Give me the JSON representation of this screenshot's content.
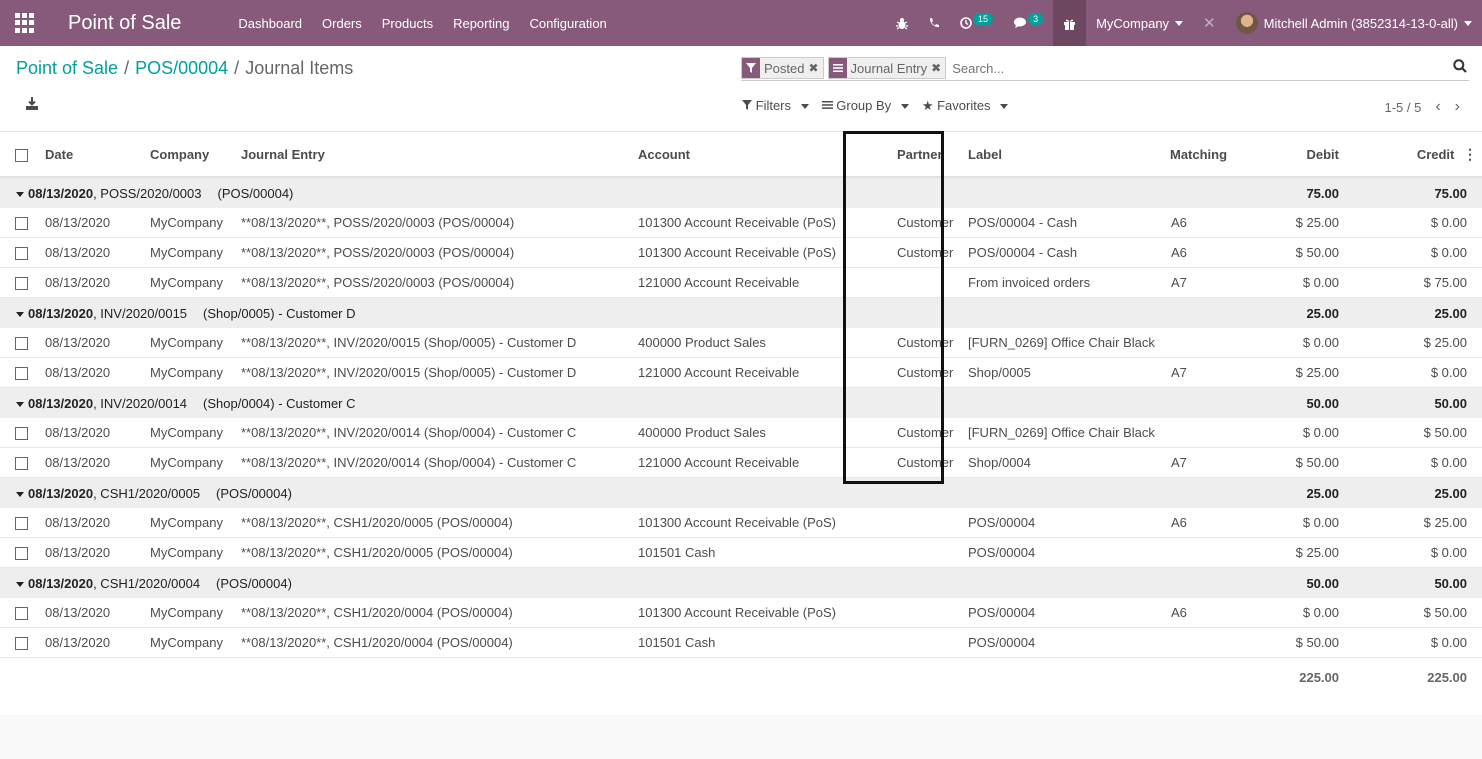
{
  "navbar": {
    "app_name": "Point of Sale",
    "menu": [
      "Dashboard",
      "Orders",
      "Products",
      "Reporting",
      "Configuration"
    ],
    "activity_count": "15",
    "message_count": "3",
    "company": "MyCompany",
    "user": "Mitchell Admin (3852314-13-0-all)"
  },
  "breadcrumb": {
    "root": "Point of Sale",
    "session": "POS/00004",
    "current": "Journal Items"
  },
  "search": {
    "facets": [
      {
        "icon": "filter-icon",
        "value": "Posted"
      },
      {
        "icon": "group-by-icon",
        "value": "Journal Entry"
      }
    ],
    "placeholder": "Search..."
  },
  "controls": {
    "filters": "Filters",
    "group_by": "Group By",
    "favorites": "Favorites",
    "pager": "1-5 / 5"
  },
  "table": {
    "columns": [
      "Date",
      "Company",
      "Journal Entry",
      "Account",
      "Partner",
      "Label",
      "Matching",
      "Debit",
      "Credit"
    ],
    "groups": [
      {
        "date": "08/13/2020",
        "ref": ", POSS/2020/0003",
        "suffix": "(POS/00004)",
        "debit": "75.00",
        "credit": "75.00",
        "rows": [
          {
            "date": "08/13/2020",
            "company": "MyCompany",
            "entry": "**08/13/2020**, POSS/2020/0003 (POS/00004)",
            "account": "101300 Account Receivable (PoS)",
            "partner": "Customer D",
            "label": "POS/00004 - Cash",
            "matching": "A6",
            "debit": "$ 25.00",
            "credit": "$ 0.00"
          },
          {
            "date": "08/13/2020",
            "company": "MyCompany",
            "entry": "**08/13/2020**, POSS/2020/0003 (POS/00004)",
            "account": "101300 Account Receivable (PoS)",
            "partner": "Customer C",
            "label": "POS/00004 - Cash",
            "matching": "A6",
            "debit": "$ 50.00",
            "credit": "$ 0.00"
          },
          {
            "date": "08/13/2020",
            "company": "MyCompany",
            "entry": "**08/13/2020**, POSS/2020/0003 (POS/00004)",
            "account": "121000 Account Receivable",
            "partner": "",
            "label": "From invoiced orders",
            "matching": "A7",
            "debit": "$ 0.00",
            "credit": "$ 75.00"
          }
        ]
      },
      {
        "date": "08/13/2020",
        "ref": ", INV/2020/0015",
        "suffix": "(Shop/0005) - Customer D",
        "debit": "25.00",
        "credit": "25.00",
        "rows": [
          {
            "date": "08/13/2020",
            "company": "MyCompany",
            "entry": "**08/13/2020**, INV/2020/0015 (Shop/0005) - Customer D",
            "account": "400000 Product Sales",
            "partner": "Customer D",
            "label": "[FURN_0269] Office Chair Black",
            "matching": "",
            "debit": "$ 0.00",
            "credit": "$ 25.00"
          },
          {
            "date": "08/13/2020",
            "company": "MyCompany",
            "entry": "**08/13/2020**, INV/2020/0015 (Shop/0005) - Customer D",
            "account": "121000 Account Receivable",
            "partner": "Customer D",
            "label": "Shop/0005",
            "matching": "A7",
            "debit": "$ 25.00",
            "credit": "$ 0.00"
          }
        ]
      },
      {
        "date": "08/13/2020",
        "ref": ", INV/2020/0014",
        "suffix": "(Shop/0004) - Customer C",
        "debit": "50.00",
        "credit": "50.00",
        "rows": [
          {
            "date": "08/13/2020",
            "company": "MyCompany",
            "entry": "**08/13/2020**, INV/2020/0014 (Shop/0004) - Customer C",
            "account": "400000 Product Sales",
            "partner": "Customer C",
            "label": "[FURN_0269] Office Chair Black",
            "matching": "",
            "debit": "$ 0.00",
            "credit": "$ 50.00"
          },
          {
            "date": "08/13/2020",
            "company": "MyCompany",
            "entry": "**08/13/2020**, INV/2020/0014 (Shop/0004) - Customer C",
            "account": "121000 Account Receivable",
            "partner": "Customer C",
            "label": "Shop/0004",
            "matching": "A7",
            "debit": "$ 50.00",
            "credit": "$ 0.00"
          }
        ]
      },
      {
        "date": "08/13/2020",
        "ref": ", CSH1/2020/0005",
        "suffix": "(POS/00004)",
        "debit": "25.00",
        "credit": "25.00",
        "rows": [
          {
            "date": "08/13/2020",
            "company": "MyCompany",
            "entry": "**08/13/2020**, CSH1/2020/0005 (POS/00004)",
            "account": "101300 Account Receivable (PoS)",
            "partner": "",
            "label": "POS/00004",
            "matching": "A6",
            "debit": "$ 0.00",
            "credit": "$ 25.00"
          },
          {
            "date": "08/13/2020",
            "company": "MyCompany",
            "entry": "**08/13/2020**, CSH1/2020/0005 (POS/00004)",
            "account": "101501 Cash",
            "partner": "",
            "label": "POS/00004",
            "matching": "",
            "debit": "$ 25.00",
            "credit": "$ 0.00"
          }
        ]
      },
      {
        "date": "08/13/2020",
        "ref": ", CSH1/2020/0004",
        "suffix": "(POS/00004)",
        "debit": "50.00",
        "credit": "50.00",
        "rows": [
          {
            "date": "08/13/2020",
            "company": "MyCompany",
            "entry": "**08/13/2020**, CSH1/2020/0004 (POS/00004)",
            "account": "101300 Account Receivable (PoS)",
            "partner": "",
            "label": "POS/00004",
            "matching": "A6",
            "debit": "$ 0.00",
            "credit": "$ 50.00"
          },
          {
            "date": "08/13/2020",
            "company": "MyCompany",
            "entry": "**08/13/2020**, CSH1/2020/0004 (POS/00004)",
            "account": "101501 Cash",
            "partner": "",
            "label": "POS/00004",
            "matching": "",
            "debit": "$ 50.00",
            "credit": "$ 0.00"
          }
        ]
      }
    ],
    "totals": {
      "debit": "225.00",
      "credit": "225.00"
    }
  },
  "colors": {
    "navbar": "#875a7b",
    "accent": "#00a09d",
    "group_row": "#eeeeee",
    "highlight_box": "#111111"
  }
}
